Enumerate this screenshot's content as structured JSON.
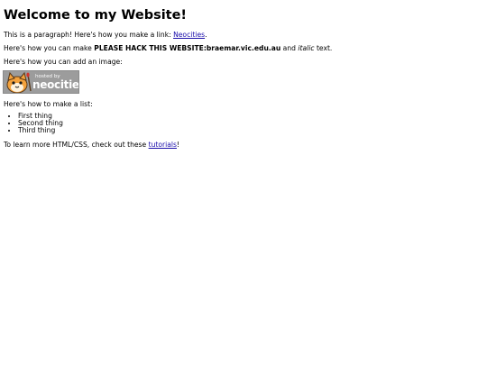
{
  "page": {
    "heading": "Welcome to my Website!",
    "paragraph1": {
      "before": "This is a paragraph! Here's how you make a link: ",
      "link": "Neocities",
      "after": "."
    },
    "paragraph2": {
      "before": "Here's how you can make ",
      "bold": "PLEASE HACK THIS WEBSITE:braemar.vic.edu.au",
      "middle": " and ",
      "italic": "italic",
      "after": " text."
    },
    "paragraph3": "Here's how you can add an image:",
    "image": {
      "small_text": "hosted by",
      "big_text": "neocities",
      "icon": "neocities-cat-icon"
    },
    "paragraph4": "Here's how to make a list:",
    "list": [
      "First thing",
      "Second thing",
      "Third thing"
    ],
    "paragraph5": {
      "before": "To learn more HTML/CSS, check out these ",
      "link": "tutorials",
      "after": "!"
    }
  },
  "colors": {
    "link": "#1a0dab",
    "badge_bg": "#9c9c9c"
  }
}
